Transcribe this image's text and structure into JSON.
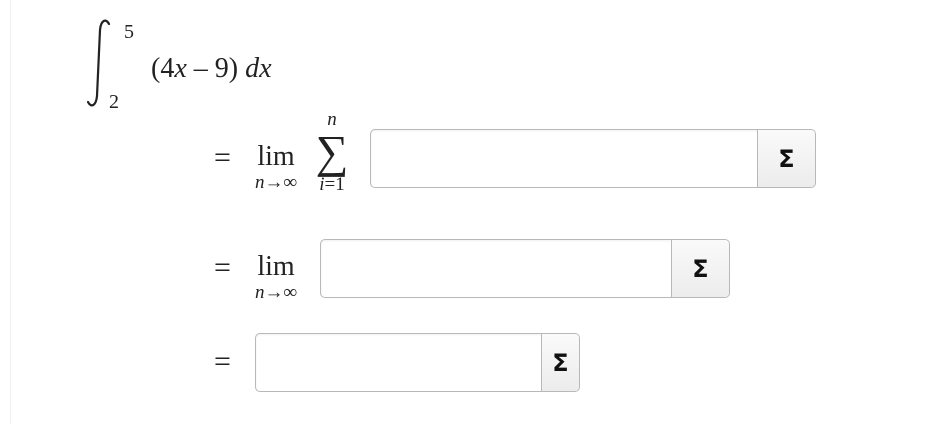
{
  "integral": {
    "upper_limit": "5",
    "lower_limit": "2",
    "integrand_open": "(4",
    "integrand_var": "x",
    "integrand_rest": " – 9) ",
    "differential": "dx"
  },
  "rows": [
    {
      "equals": "=",
      "lim_word": "lim",
      "lim_sub": "n→∞",
      "sigma_upper": "n",
      "sigma_symbol": "∑",
      "sigma_lower_var": "i",
      "sigma_lower_rest": "=1",
      "input_value": "",
      "button_label": "Σ"
    },
    {
      "equals": "=",
      "lim_word": "lim",
      "lim_sub": "n→∞",
      "input_value": "",
      "button_label": "Σ"
    },
    {
      "equals": "=",
      "input_value": "",
      "button_label": "Σ"
    }
  ]
}
